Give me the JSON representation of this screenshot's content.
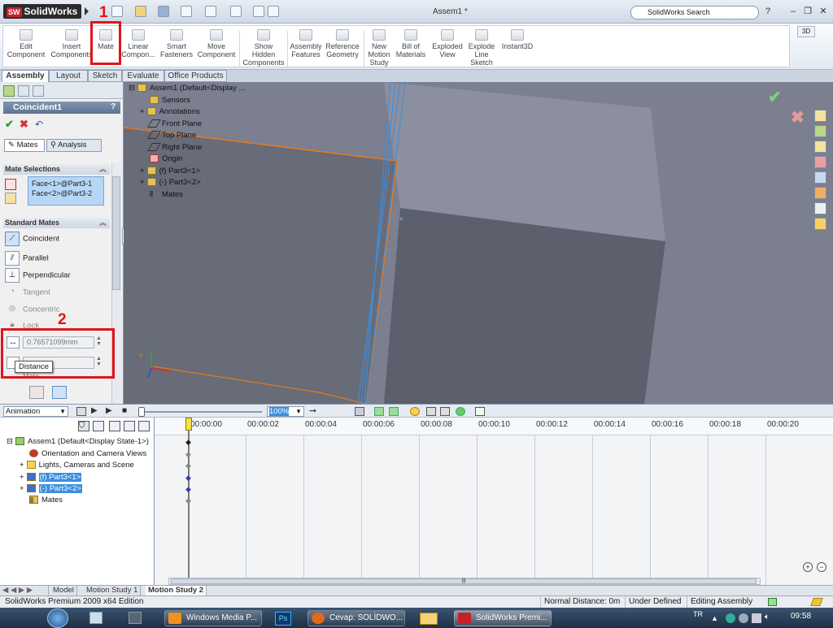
{
  "window": {
    "app_name": "SolidWorks",
    "app_badge": "SW",
    "document_title": "Assem1 *",
    "search_placeholder": "SolidWorks Search",
    "help": "?"
  },
  "ribbon": {
    "buttons": [
      {
        "label": "Edit\nComponent"
      },
      {
        "label": "Insert\nComponents"
      },
      {
        "label": "Mate"
      },
      {
        "label": "Linear\nCompon..."
      },
      {
        "label": "Smart\nFasteners"
      },
      {
        "label": "Move\nComponent"
      },
      {
        "label": "Show\nHidden\nComponents"
      },
      {
        "label": "Assembly\nFeatures"
      },
      {
        "label": "Reference\nGeometry"
      },
      {
        "label": "New\nMotion\nStudy"
      },
      {
        "label": "Bill of\nMaterials"
      },
      {
        "label": "Exploded\nView"
      },
      {
        "label": "Explode\nLine\nSketch"
      },
      {
        "label": "Instant3D"
      }
    ]
  },
  "command_tabs": [
    "Assembly",
    "Layout",
    "Sketch",
    "Evaluate",
    "Office Products"
  ],
  "property_manager": {
    "title": "Coincident1",
    "help": "?",
    "tabs": [
      "Mates",
      "Analysis"
    ],
    "mate_selections_header": "Mate Selections",
    "selections": [
      "Face<1>@Part3-1",
      "Face<2>@Part3-2"
    ],
    "standard_mates_header": "Standard Mates",
    "mates": [
      {
        "label": "Coincident",
        "enabled": true
      },
      {
        "label": "Parallel",
        "enabled": true
      },
      {
        "label": "Perpendicular",
        "enabled": true
      },
      {
        "label": "Tangent",
        "enabled": false
      },
      {
        "label": "Concentric",
        "enabled": false
      },
      {
        "label": "Lock",
        "enabled": false
      }
    ],
    "distance_value": "0.76571099mm",
    "tooltip": "Distance",
    "hidden_label": "Mate"
  },
  "feature_tree": {
    "items": [
      "Assem1  (Default<Display ...",
      "Sensors",
      "Annotations",
      "Front Plane",
      "Top Plane",
      "Right Plane",
      "Origin",
      "(f) Part3<1>",
      "(-) Part3<2>",
      "Mates"
    ]
  },
  "animation": {
    "mode": "Animation",
    "zoom": "100%",
    "timecodes": [
      "00:00:00",
      "00:00:02",
      "00:00:04",
      "00:00:06",
      "00:00:08",
      "00:00:10",
      "00:00:12",
      "00:00:14",
      "00:00:16",
      "00:00:18",
      "00:00:20"
    ],
    "tree": [
      "Assem1  (Default<Display State-1>)",
      "Orientation and Camera Views",
      "Lights, Cameras and Scene",
      "(f) Part3<1>",
      "(-) Part3<2>",
      "Mates"
    ]
  },
  "bottom_tabs": [
    "Model",
    "Motion Study 1",
    "Motion Study 2"
  ],
  "status": {
    "edition": "SolidWorks Premium 2009 x64 Edition",
    "normal_distance": "Normal Distance: 0m",
    "state": "Under Defined",
    "mode": "Editing Assembly"
  },
  "taskbar": {
    "items": [
      "Windows Media P...",
      "Cevap: SOLİDWO...",
      "SolidWorks Premi..."
    ],
    "language": "TR",
    "clock": "09:58"
  },
  "annotations": {
    "one": "1",
    "two": "2"
  },
  "colors": {
    "annotation_red": "#e0141c",
    "selection_blue": "#3b8fe0",
    "edge_orange": "#e47a1c",
    "accept_green": "#2fa32f",
    "cancel_red": "#d83030"
  }
}
